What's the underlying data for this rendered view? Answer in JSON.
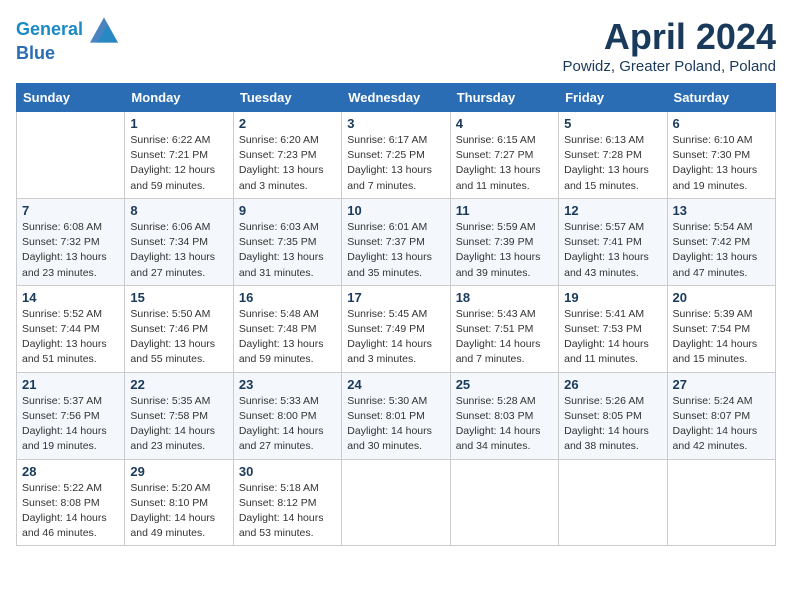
{
  "header": {
    "logo_line1": "General",
    "logo_line2": "Blue",
    "month_title": "April 2024",
    "location": "Powidz, Greater Poland, Poland"
  },
  "weekdays": [
    "Sunday",
    "Monday",
    "Tuesday",
    "Wednesday",
    "Thursday",
    "Friday",
    "Saturday"
  ],
  "weeks": [
    [
      {
        "day": "",
        "info": ""
      },
      {
        "day": "1",
        "info": "Sunrise: 6:22 AM\nSunset: 7:21 PM\nDaylight: 12 hours\nand 59 minutes."
      },
      {
        "day": "2",
        "info": "Sunrise: 6:20 AM\nSunset: 7:23 PM\nDaylight: 13 hours\nand 3 minutes."
      },
      {
        "day": "3",
        "info": "Sunrise: 6:17 AM\nSunset: 7:25 PM\nDaylight: 13 hours\nand 7 minutes."
      },
      {
        "day": "4",
        "info": "Sunrise: 6:15 AM\nSunset: 7:27 PM\nDaylight: 13 hours\nand 11 minutes."
      },
      {
        "day": "5",
        "info": "Sunrise: 6:13 AM\nSunset: 7:28 PM\nDaylight: 13 hours\nand 15 minutes."
      },
      {
        "day": "6",
        "info": "Sunrise: 6:10 AM\nSunset: 7:30 PM\nDaylight: 13 hours\nand 19 minutes."
      }
    ],
    [
      {
        "day": "7",
        "info": "Sunrise: 6:08 AM\nSunset: 7:32 PM\nDaylight: 13 hours\nand 23 minutes."
      },
      {
        "day": "8",
        "info": "Sunrise: 6:06 AM\nSunset: 7:34 PM\nDaylight: 13 hours\nand 27 minutes."
      },
      {
        "day": "9",
        "info": "Sunrise: 6:03 AM\nSunset: 7:35 PM\nDaylight: 13 hours\nand 31 minutes."
      },
      {
        "day": "10",
        "info": "Sunrise: 6:01 AM\nSunset: 7:37 PM\nDaylight: 13 hours\nand 35 minutes."
      },
      {
        "day": "11",
        "info": "Sunrise: 5:59 AM\nSunset: 7:39 PM\nDaylight: 13 hours\nand 39 minutes."
      },
      {
        "day": "12",
        "info": "Sunrise: 5:57 AM\nSunset: 7:41 PM\nDaylight: 13 hours\nand 43 minutes."
      },
      {
        "day": "13",
        "info": "Sunrise: 5:54 AM\nSunset: 7:42 PM\nDaylight: 13 hours\nand 47 minutes."
      }
    ],
    [
      {
        "day": "14",
        "info": "Sunrise: 5:52 AM\nSunset: 7:44 PM\nDaylight: 13 hours\nand 51 minutes."
      },
      {
        "day": "15",
        "info": "Sunrise: 5:50 AM\nSunset: 7:46 PM\nDaylight: 13 hours\nand 55 minutes."
      },
      {
        "day": "16",
        "info": "Sunrise: 5:48 AM\nSunset: 7:48 PM\nDaylight: 13 hours\nand 59 minutes."
      },
      {
        "day": "17",
        "info": "Sunrise: 5:45 AM\nSunset: 7:49 PM\nDaylight: 14 hours\nand 3 minutes."
      },
      {
        "day": "18",
        "info": "Sunrise: 5:43 AM\nSunset: 7:51 PM\nDaylight: 14 hours\nand 7 minutes."
      },
      {
        "day": "19",
        "info": "Sunrise: 5:41 AM\nSunset: 7:53 PM\nDaylight: 14 hours\nand 11 minutes."
      },
      {
        "day": "20",
        "info": "Sunrise: 5:39 AM\nSunset: 7:54 PM\nDaylight: 14 hours\nand 15 minutes."
      }
    ],
    [
      {
        "day": "21",
        "info": "Sunrise: 5:37 AM\nSunset: 7:56 PM\nDaylight: 14 hours\nand 19 minutes."
      },
      {
        "day": "22",
        "info": "Sunrise: 5:35 AM\nSunset: 7:58 PM\nDaylight: 14 hours\nand 23 minutes."
      },
      {
        "day": "23",
        "info": "Sunrise: 5:33 AM\nSunset: 8:00 PM\nDaylight: 14 hours\nand 27 minutes."
      },
      {
        "day": "24",
        "info": "Sunrise: 5:30 AM\nSunset: 8:01 PM\nDaylight: 14 hours\nand 30 minutes."
      },
      {
        "day": "25",
        "info": "Sunrise: 5:28 AM\nSunset: 8:03 PM\nDaylight: 14 hours\nand 34 minutes."
      },
      {
        "day": "26",
        "info": "Sunrise: 5:26 AM\nSunset: 8:05 PM\nDaylight: 14 hours\nand 38 minutes."
      },
      {
        "day": "27",
        "info": "Sunrise: 5:24 AM\nSunset: 8:07 PM\nDaylight: 14 hours\nand 42 minutes."
      }
    ],
    [
      {
        "day": "28",
        "info": "Sunrise: 5:22 AM\nSunset: 8:08 PM\nDaylight: 14 hours\nand 46 minutes."
      },
      {
        "day": "29",
        "info": "Sunrise: 5:20 AM\nSunset: 8:10 PM\nDaylight: 14 hours\nand 49 minutes."
      },
      {
        "day": "30",
        "info": "Sunrise: 5:18 AM\nSunset: 8:12 PM\nDaylight: 14 hours\nand 53 minutes."
      },
      {
        "day": "",
        "info": ""
      },
      {
        "day": "",
        "info": ""
      },
      {
        "day": "",
        "info": ""
      },
      {
        "day": "",
        "info": ""
      }
    ]
  ]
}
